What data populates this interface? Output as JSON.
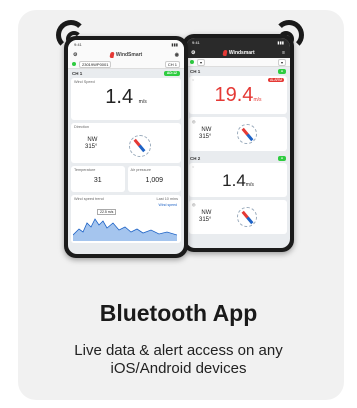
{
  "phone_front": {
    "time": "9:41",
    "app_name": "WindSmart",
    "device_id": "23019WP0001",
    "channel_select": "CH 1",
    "channel_label": "CH 1",
    "channel_status": "AD:12",
    "wind_speed_label": "Wind Speed",
    "wind_speed_value": "1.4",
    "wind_speed_unit": "m/s",
    "direction_label": "Direction",
    "direction_value": "NW",
    "direction_degrees": "315°",
    "temperature_label": "Temperature",
    "temperature_value": "31",
    "pressure_label": "Air pressure",
    "pressure_value": "1,009",
    "chart_label": "Wind speed trend",
    "chart_range": "Last 10 mins",
    "chart_legend": "Wind speed",
    "chart_tooltip": "22.5 m/s"
  },
  "phone_back": {
    "app_name": "Windsmart",
    "ch1_label": "CH 1",
    "alarm_badge": "ALARM",
    "ch1_speed_value": "19.4",
    "ch1_speed_unit": "m/s",
    "ch1_direction": "NW",
    "ch1_degrees": "315°",
    "ch2_label": "CH 2",
    "ch2_speed_value": "1.4",
    "ch2_speed_unit": "m/s",
    "ch2_direction": "NW",
    "ch2_degrees": "315°"
  },
  "headline": "Bluetooth App",
  "description_line1": "Live data & alert access on any",
  "description_line2": "iOS/Android devices",
  "colors": {
    "accent_red": "#e53935",
    "status_green": "#2ecc40",
    "compass_blue": "#1e63c6"
  }
}
